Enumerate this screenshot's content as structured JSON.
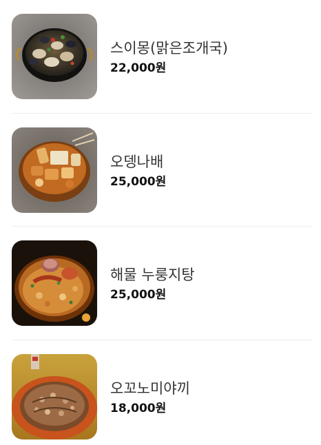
{
  "menu": {
    "items": [
      {
        "name": "스이몽(맑은조개국)",
        "price": "22,000원",
        "image": "clam-soup-photo"
      },
      {
        "name": "오뎅나배",
        "price": "25,000원",
        "image": "oden-hotpot-photo"
      },
      {
        "name": "해물 누룽지탕",
        "price": "25,000원",
        "image": "seafood-nurungji-photo"
      },
      {
        "name": "오꼬노미야끼",
        "price": "18,000원",
        "image": "okonomiyaki-photo"
      }
    ]
  },
  "colors": {
    "name_text": "#333333",
    "price_text": "#111111",
    "divider": "#ededed"
  }
}
